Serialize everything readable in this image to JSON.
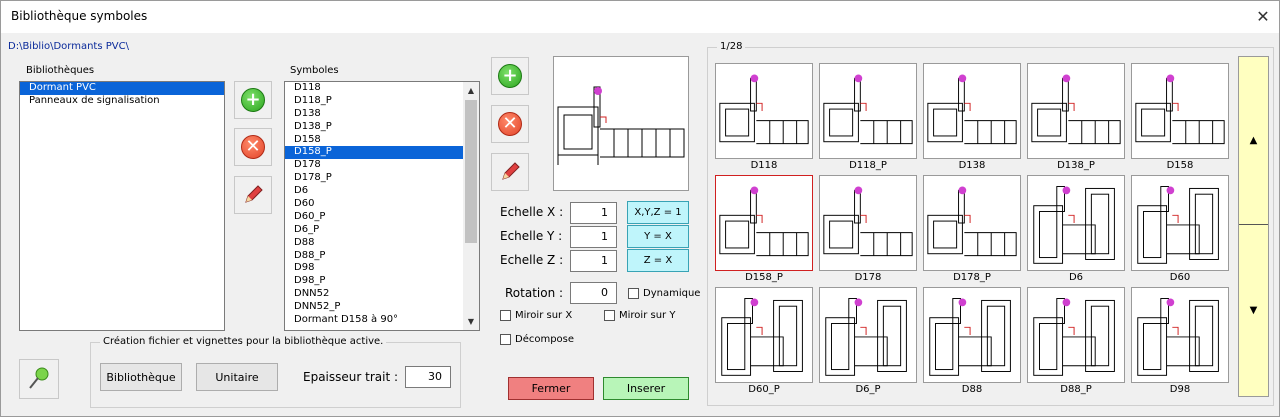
{
  "window": {
    "title": "Bibliothèque symboles",
    "close_glyph": "✕"
  },
  "path": "D:\\Biblio\\Dormants PVC\\",
  "libraries": {
    "label": "Bibliothèques",
    "items": [
      "Dormant PVC",
      "Panneaux de signalisation"
    ],
    "selected": 0
  },
  "symbols": {
    "label": "Symboles",
    "items": [
      "D118",
      "D118_P",
      "D138",
      "D138_P",
      "D158",
      "D158_P",
      "D178",
      "D178_P",
      "D6",
      "D60",
      "D60_P",
      "D6_P",
      "D88",
      "D88_P",
      "D98",
      "D98_P",
      "DNN52",
      "DNN52_P",
      "Dormant D158 à 90°"
    ],
    "selected": 5
  },
  "icons": {
    "add": "add-icon",
    "delete": "delete-icon",
    "edit": "pencil-icon",
    "pin": "pushpin-icon"
  },
  "scale": {
    "x_label": "Echelle X :",
    "x_value": "1",
    "y_label": "Echelle Y :",
    "y_value": "1",
    "z_label": "Echelle Z :",
    "z_value": "1",
    "btn_xyz": "X,Y,Z = 1",
    "btn_yx": "Y = X",
    "btn_zx": "Z = X"
  },
  "rotation": {
    "label": "Rotation :",
    "value": "0"
  },
  "checkboxes": {
    "dynamique": "Dynamique",
    "miroir_x": "Miroir sur X",
    "miroir_y": "Miroir sur Y",
    "decompose": "Décompose"
  },
  "creation": {
    "legend": "Création fichier et vignettes pour la bibliothèque active.",
    "btn_bibliotheque": "Bibliothèque",
    "btn_unitaire": "Unitaire",
    "epaisseur_label": "Epaisseur trait :",
    "epaisseur_value": "30"
  },
  "actions": {
    "fermer": "Fermer",
    "inserer": "Inserer"
  },
  "gallery": {
    "page": "1/28",
    "items": [
      "D118",
      "D118_P",
      "D138",
      "D138_P",
      "D158",
      "D158_P",
      "D178",
      "D178_P",
      "D6",
      "D60",
      "D60_P",
      "D6_P",
      "D88",
      "D88_P",
      "D98"
    ],
    "selected": 5
  },
  "colors": {
    "accent": "#0a64d8",
    "fermer": "#f08080",
    "inserer": "#b8f5b8",
    "cyan": "#bff5fb",
    "scroll": "#ffffc0"
  }
}
